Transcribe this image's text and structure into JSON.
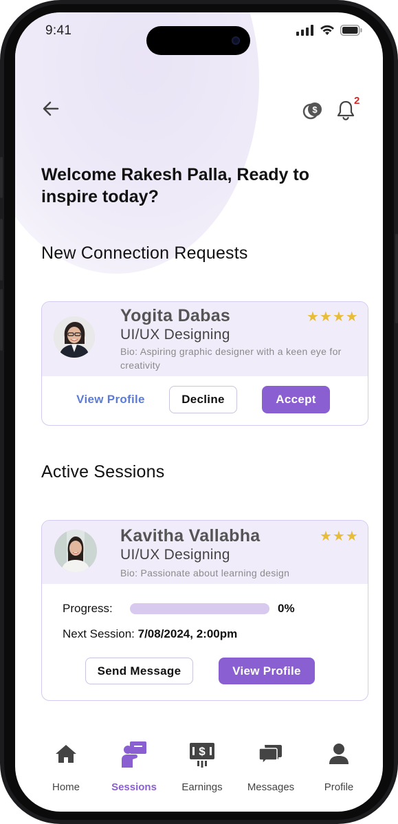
{
  "status_bar": {
    "time": "9:41"
  },
  "header": {
    "notification_count": "2"
  },
  "welcome_text": "Welcome Rakesh Palla, Ready to inspire today?",
  "connection_requests": {
    "title": "New Connection Requests",
    "items": [
      {
        "name": "Yogita Dabas",
        "skill": "UI/UX Designing",
        "bio": "Bio: Aspiring graphic designer with a keen eye for creativity",
        "stars": "★★★★",
        "view_profile_label": "View Profile",
        "decline_label": "Decline",
        "accept_label": "Accept"
      }
    ]
  },
  "active_sessions": {
    "title": "Active Sessions",
    "items": [
      {
        "name": "Kavitha Vallabha",
        "skill": "UI/UX Designing",
        "bio": "Bio: Passionate about learning design",
        "stars": "★★★",
        "progress_label": "Progress:",
        "progress_value": "0%",
        "progress_fraction": 0,
        "next_session_label": "Next Session:",
        "next_session_value": "7/08/2024, 2:00pm",
        "send_message_label": "Send Message",
        "view_profile_label": "View Profile"
      }
    ]
  },
  "tab_bar": {
    "tabs": [
      {
        "label": "Home",
        "icon": "home-icon"
      },
      {
        "label": "Sessions",
        "icon": "sessions-icon",
        "active": true
      },
      {
        "label": "Earnings",
        "icon": "earnings-icon"
      },
      {
        "label": "Messages",
        "icon": "messages-icon"
      },
      {
        "label": "Profile",
        "icon": "profile-icon"
      }
    ]
  },
  "colors": {
    "accent": "#8a5fd2",
    "link": "#5b7bd6",
    "star": "#e7bd37",
    "card_header_bg": "#f1ecfa",
    "badge": "#d12a2a"
  }
}
